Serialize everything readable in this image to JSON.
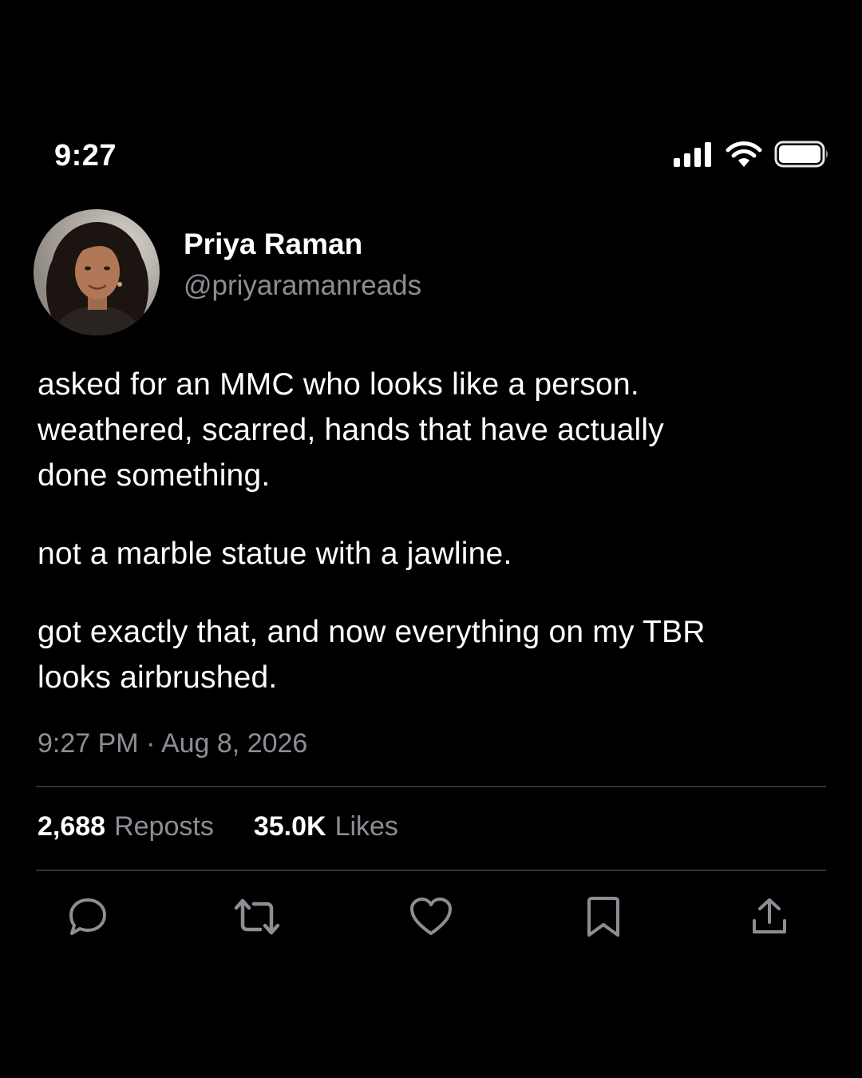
{
  "status_bar": {
    "time": "9:27",
    "icons": [
      "cellular-signal-icon",
      "wifi-icon",
      "battery-icon"
    ]
  },
  "author": {
    "display_name": "Priya Raman",
    "handle": "@priyaramanreads",
    "avatar": "profile-photo"
  },
  "post": {
    "paragraphs": [
      "asked for an MMC who looks like a person.\nweathered, scarred, hands that have actually\ndone something.",
      "not a marble statue with a jawline.",
      "got exactly that, and now everything on my TBR\nlooks airbrushed."
    ],
    "timestamp": "9:27 PM · Aug 8, 2026"
  },
  "stats": {
    "reposts_count": "2,688",
    "reposts_label": "Reposts",
    "likes_count": "35.0K",
    "likes_label": "Likes"
  },
  "actions": [
    "reply-icon",
    "repost-icon",
    "like-icon",
    "bookmark-icon",
    "share-icon"
  ],
  "colors": {
    "background": "#000000",
    "primary_text": "#ffffff",
    "secondary_text": "#8b8f95",
    "divider": "#2f3336"
  }
}
